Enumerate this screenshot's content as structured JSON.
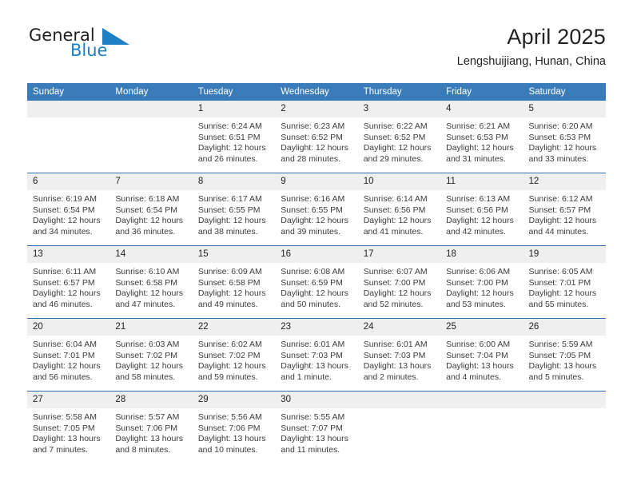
{
  "brand": {
    "word1": "General",
    "word2": "Blue",
    "triangle_color": "#1f7fc4",
    "word1_color": "#231f20",
    "word2_color": "#1f7fc4"
  },
  "header": {
    "title": "April 2025",
    "location": "Lengshuijiang, Hunan, China"
  },
  "theme": {
    "header_bg": "#3a7cb9",
    "row_separator": "#2f6fae",
    "daynum_bg": "#efefef",
    "text": "#3b3b3b"
  },
  "weekday_headers": [
    "Sunday",
    "Monday",
    "Tuesday",
    "Wednesday",
    "Thursday",
    "Friday",
    "Saturday"
  ],
  "weeks": [
    [
      {
        "day": "",
        "sunrise": "",
        "sunset": "",
        "daylight": ""
      },
      {
        "day": "",
        "sunrise": "",
        "sunset": "",
        "daylight": ""
      },
      {
        "day": "1",
        "sunrise": "Sunrise: 6:24 AM",
        "sunset": "Sunset: 6:51 PM",
        "daylight": "Daylight: 12 hours and 26 minutes."
      },
      {
        "day": "2",
        "sunrise": "Sunrise: 6:23 AM",
        "sunset": "Sunset: 6:52 PM",
        "daylight": "Daylight: 12 hours and 28 minutes."
      },
      {
        "day": "3",
        "sunrise": "Sunrise: 6:22 AM",
        "sunset": "Sunset: 6:52 PM",
        "daylight": "Daylight: 12 hours and 29 minutes."
      },
      {
        "day": "4",
        "sunrise": "Sunrise: 6:21 AM",
        "sunset": "Sunset: 6:53 PM",
        "daylight": "Daylight: 12 hours and 31 minutes."
      },
      {
        "day": "5",
        "sunrise": "Sunrise: 6:20 AM",
        "sunset": "Sunset: 6:53 PM",
        "daylight": "Daylight: 12 hours and 33 minutes."
      }
    ],
    [
      {
        "day": "6",
        "sunrise": "Sunrise: 6:19 AM",
        "sunset": "Sunset: 6:54 PM",
        "daylight": "Daylight: 12 hours and 34 minutes."
      },
      {
        "day": "7",
        "sunrise": "Sunrise: 6:18 AM",
        "sunset": "Sunset: 6:54 PM",
        "daylight": "Daylight: 12 hours and 36 minutes."
      },
      {
        "day": "8",
        "sunrise": "Sunrise: 6:17 AM",
        "sunset": "Sunset: 6:55 PM",
        "daylight": "Daylight: 12 hours and 38 minutes."
      },
      {
        "day": "9",
        "sunrise": "Sunrise: 6:16 AM",
        "sunset": "Sunset: 6:55 PM",
        "daylight": "Daylight: 12 hours and 39 minutes."
      },
      {
        "day": "10",
        "sunrise": "Sunrise: 6:14 AM",
        "sunset": "Sunset: 6:56 PM",
        "daylight": "Daylight: 12 hours and 41 minutes."
      },
      {
        "day": "11",
        "sunrise": "Sunrise: 6:13 AM",
        "sunset": "Sunset: 6:56 PM",
        "daylight": "Daylight: 12 hours and 42 minutes."
      },
      {
        "day": "12",
        "sunrise": "Sunrise: 6:12 AM",
        "sunset": "Sunset: 6:57 PM",
        "daylight": "Daylight: 12 hours and 44 minutes."
      }
    ],
    [
      {
        "day": "13",
        "sunrise": "Sunrise: 6:11 AM",
        "sunset": "Sunset: 6:57 PM",
        "daylight": "Daylight: 12 hours and 46 minutes."
      },
      {
        "day": "14",
        "sunrise": "Sunrise: 6:10 AM",
        "sunset": "Sunset: 6:58 PM",
        "daylight": "Daylight: 12 hours and 47 minutes."
      },
      {
        "day": "15",
        "sunrise": "Sunrise: 6:09 AM",
        "sunset": "Sunset: 6:58 PM",
        "daylight": "Daylight: 12 hours and 49 minutes."
      },
      {
        "day": "16",
        "sunrise": "Sunrise: 6:08 AM",
        "sunset": "Sunset: 6:59 PM",
        "daylight": "Daylight: 12 hours and 50 minutes."
      },
      {
        "day": "17",
        "sunrise": "Sunrise: 6:07 AM",
        "sunset": "Sunset: 7:00 PM",
        "daylight": "Daylight: 12 hours and 52 minutes."
      },
      {
        "day": "18",
        "sunrise": "Sunrise: 6:06 AM",
        "sunset": "Sunset: 7:00 PM",
        "daylight": "Daylight: 12 hours and 53 minutes."
      },
      {
        "day": "19",
        "sunrise": "Sunrise: 6:05 AM",
        "sunset": "Sunset: 7:01 PM",
        "daylight": "Daylight: 12 hours and 55 minutes."
      }
    ],
    [
      {
        "day": "20",
        "sunrise": "Sunrise: 6:04 AM",
        "sunset": "Sunset: 7:01 PM",
        "daylight": "Daylight: 12 hours and 56 minutes."
      },
      {
        "day": "21",
        "sunrise": "Sunrise: 6:03 AM",
        "sunset": "Sunset: 7:02 PM",
        "daylight": "Daylight: 12 hours and 58 minutes."
      },
      {
        "day": "22",
        "sunrise": "Sunrise: 6:02 AM",
        "sunset": "Sunset: 7:02 PM",
        "daylight": "Daylight: 12 hours and 59 minutes."
      },
      {
        "day": "23",
        "sunrise": "Sunrise: 6:01 AM",
        "sunset": "Sunset: 7:03 PM",
        "daylight": "Daylight: 13 hours and 1 minute."
      },
      {
        "day": "24",
        "sunrise": "Sunrise: 6:01 AM",
        "sunset": "Sunset: 7:03 PM",
        "daylight": "Daylight: 13 hours and 2 minutes."
      },
      {
        "day": "25",
        "sunrise": "Sunrise: 6:00 AM",
        "sunset": "Sunset: 7:04 PM",
        "daylight": "Daylight: 13 hours and 4 minutes."
      },
      {
        "day": "26",
        "sunrise": "Sunrise: 5:59 AM",
        "sunset": "Sunset: 7:05 PM",
        "daylight": "Daylight: 13 hours and 5 minutes."
      }
    ],
    [
      {
        "day": "27",
        "sunrise": "Sunrise: 5:58 AM",
        "sunset": "Sunset: 7:05 PM",
        "daylight": "Daylight: 13 hours and 7 minutes."
      },
      {
        "day": "28",
        "sunrise": "Sunrise: 5:57 AM",
        "sunset": "Sunset: 7:06 PM",
        "daylight": "Daylight: 13 hours and 8 minutes."
      },
      {
        "day": "29",
        "sunrise": "Sunrise: 5:56 AM",
        "sunset": "Sunset: 7:06 PM",
        "daylight": "Daylight: 13 hours and 10 minutes."
      },
      {
        "day": "30",
        "sunrise": "Sunrise: 5:55 AM",
        "sunset": "Sunset: 7:07 PM",
        "daylight": "Daylight: 13 hours and 11 minutes."
      },
      {
        "day": "",
        "sunrise": "",
        "sunset": "",
        "daylight": ""
      },
      {
        "day": "",
        "sunrise": "",
        "sunset": "",
        "daylight": ""
      },
      {
        "day": "",
        "sunrise": "",
        "sunset": "",
        "daylight": ""
      }
    ]
  ]
}
